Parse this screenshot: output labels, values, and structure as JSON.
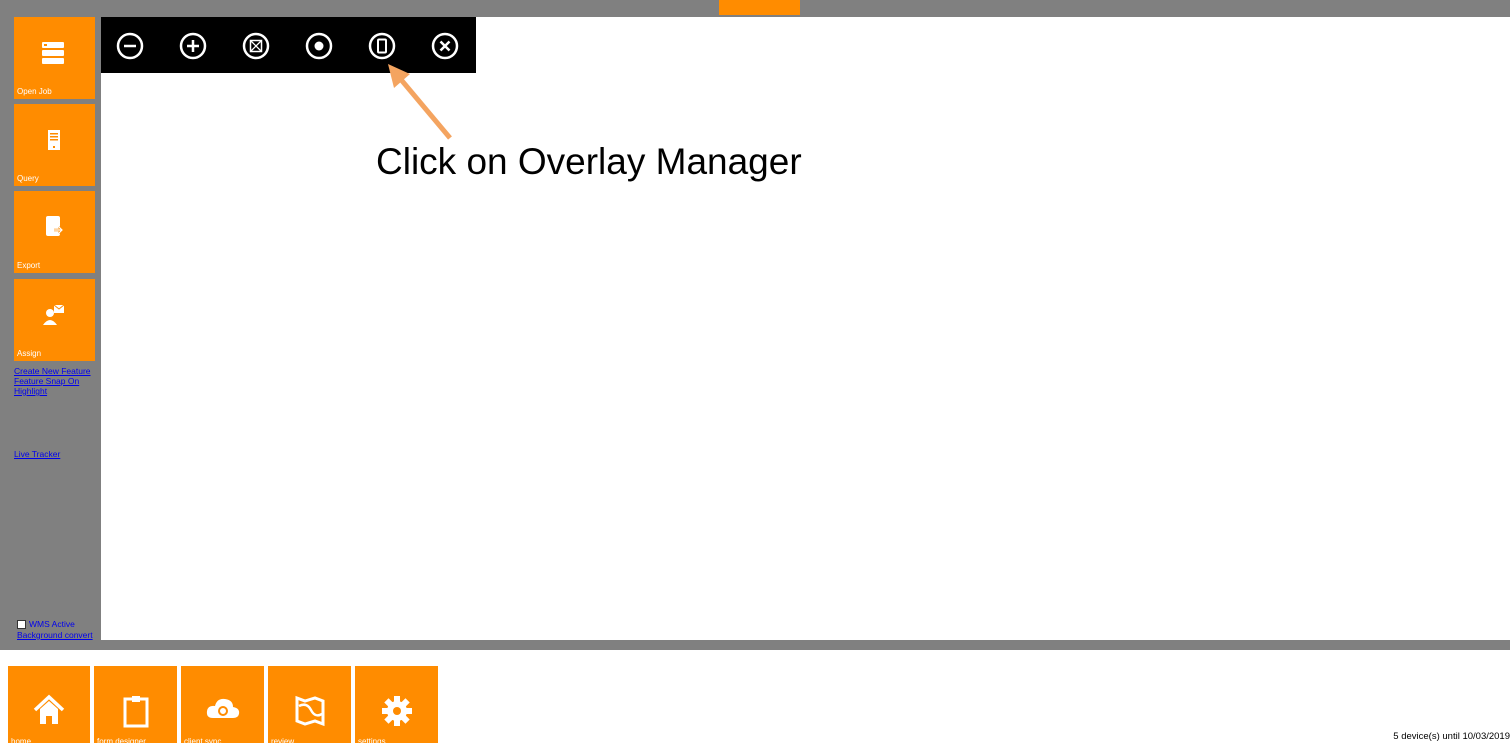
{
  "sidebar": {
    "tiles": [
      {
        "label": "Open Job",
        "icon": "database-icon"
      },
      {
        "label": "Query",
        "icon": "document-icon"
      },
      {
        "label": "Export",
        "icon": "export-icon"
      },
      {
        "label": "Assign",
        "icon": "assign-user-icon"
      }
    ],
    "links": {
      "create_new_feature": "Create New Feature",
      "feature_snap_on": "Feature Snap On",
      "highlight": "Highlight",
      "live_tracker": "Live Tracker"
    },
    "wms_active": {
      "label": "WMS Active",
      "checked": false
    },
    "background_convert": "Background convert"
  },
  "toolbar": {
    "buttons": [
      {
        "icon": "zoom-out-icon"
      },
      {
        "icon": "zoom-in-icon"
      },
      {
        "icon": "zoom-extent-icon"
      },
      {
        "icon": "gps-center-icon"
      },
      {
        "icon": "overlay-manager-icon"
      },
      {
        "icon": "close-icon"
      }
    ]
  },
  "annotation": {
    "text": "Click on Overlay Manager"
  },
  "bottom_nav": [
    {
      "label": "home",
      "icon": "home-icon"
    },
    {
      "label": "form designer",
      "icon": "clipboard-icon"
    },
    {
      "label": "client sync",
      "icon": "cloud-sync-icon"
    },
    {
      "label": "review",
      "icon": "map-icon"
    },
    {
      "label": "settings",
      "icon": "gear-icon"
    }
  ],
  "license_text": "5 device(s) until 10/03/2019",
  "colors": {
    "accent": "#ff8c00",
    "frame": "#808080",
    "toolbar": "#000000",
    "arrow": "#f4a460"
  }
}
